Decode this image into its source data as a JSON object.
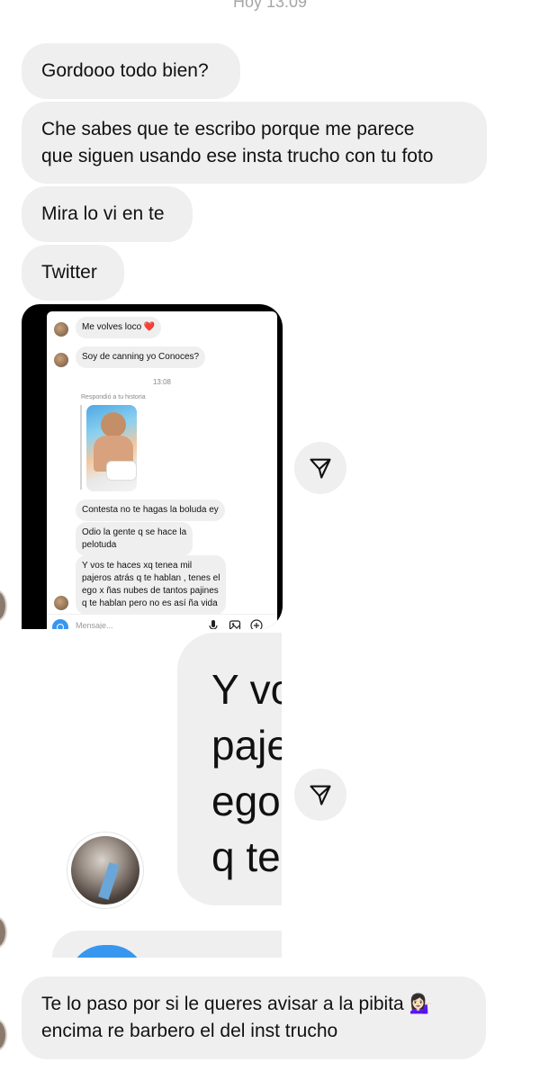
{
  "header": {
    "time": "Hoy 13:09"
  },
  "messages": {
    "m1": "Gordooo todo bien?",
    "m2_line1": "Che sabes que te escribo porque me parece",
    "m2_line2": "que siguen usando ese insta trucho con tu foto",
    "m3": "Mira lo vi en te",
    "m4": "Twitter",
    "m5_line1": "Te lo paso por si le queres avisar a la pibita 💁🏻‍♀️",
    "m5_line2": "encima re barbero el del inst trucho"
  },
  "screenshot": {
    "msg1": "Me volves loco ❤️",
    "msg2": "Soy de canning yo Conoces?",
    "time": "13:08",
    "reply_label": "Respondió a tu historia",
    "msg3": "Contesta no te hagas la boluda ey",
    "msg4_line1": "Odio la gente q se hace la",
    "msg4_line2": "pelotuda",
    "msg5_line1": "Y vos te haces xq tenea mil",
    "msg5_line2": "pajeros atrás q te hablan , tenes el",
    "msg5_line3": "ego x ñas nubes de tantos pajines",
    "msg5_line4": "q te hablan pero no es así ña vida",
    "input_placeholder": "Mensaje..."
  },
  "zoomed": {
    "line1": "Y vo",
    "line2": "paje",
    "line3": "ego",
    "line4": "q te"
  },
  "icons": {
    "share": "paper-plane-icon",
    "camera": "camera-icon",
    "mic": "microphone-icon",
    "gallery": "gallery-icon",
    "add": "plus-circle-icon"
  },
  "colors": {
    "bubble": "#efefef",
    "accent": "#3797f0"
  }
}
